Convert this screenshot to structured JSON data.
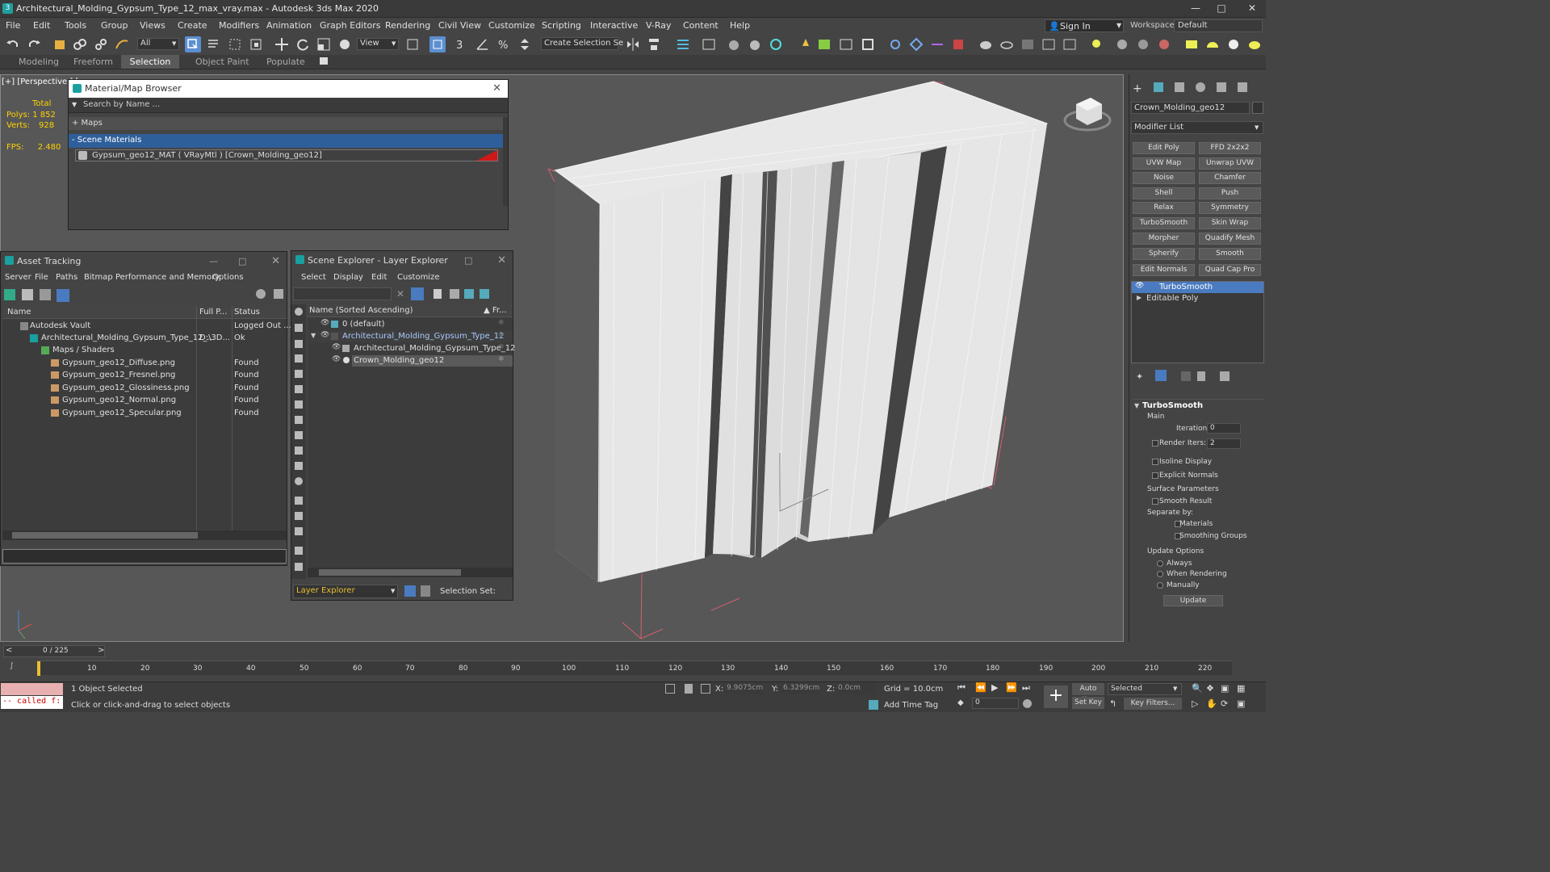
{
  "window": {
    "title": "Architectural_Molding_Gypsum_Type_12_max_vray.max - Autodesk 3ds Max 2020"
  },
  "menu": [
    "File",
    "Edit",
    "Tools",
    "Group",
    "Views",
    "Create",
    "Modifiers",
    "Animation",
    "Graph Editors",
    "Rendering",
    "Civil View",
    "Customize",
    "Scripting",
    "Interactive",
    "V-Ray",
    "Content",
    "Help"
  ],
  "signin": {
    "label": "Sign In"
  },
  "workspaces": {
    "label": "Workspaces:",
    "value": "Default"
  },
  "toolbar": {
    "filter_value": "All",
    "view_value": "View",
    "create_selection_set": "Create Selection Se"
  },
  "ribbon": {
    "tabs": [
      "Modeling",
      "Freeform",
      "Selection",
      "Object Paint",
      "Populate"
    ]
  },
  "viewport": {
    "label": "[+] [Perspective ] [",
    "stats": {
      "total_label": "Total",
      "polys_label": "Polys:",
      "polys_value": "1 852",
      "verts_label": "Verts:",
      "verts_value": "928",
      "fps_label": "FPS:",
      "fps_value": "2.480"
    }
  },
  "material_browser": {
    "title": "Material/Map Browser",
    "search_placeholder": "Search by Name ...",
    "maps_label": "+ Maps",
    "scene_materials_label": "- Scene Materials",
    "material_item": "Gypsum_geo12_MAT ( VRayMtl ) [Crown_Molding_geo12]"
  },
  "asset_tracking": {
    "title": "Asset Tracking",
    "menu": [
      "Server",
      "File",
      "Paths",
      "Bitmap Performance and Memory",
      "Options"
    ],
    "columns": [
      "Name",
      "Full P...",
      "Status"
    ],
    "rows": [
      {
        "name": "Autodesk Vault",
        "path": "",
        "status": "Logged Out ..."
      },
      {
        "name": "Architectural_Molding_Gypsum_Type_12_...",
        "path": "D:\\3D...",
        "status": "Ok"
      },
      {
        "name": "Maps / Shaders",
        "path": "",
        "status": ""
      },
      {
        "name": "Gypsum_geo12_Diffuse.png",
        "path": "",
        "status": "Found"
      },
      {
        "name": "Gypsum_geo12_Fresnel.png",
        "path": "",
        "status": "Found"
      },
      {
        "name": "Gypsum_geo12_Glossiness.png",
        "path": "",
        "status": "Found"
      },
      {
        "name": "Gypsum_geo12_Normal.png",
        "path": "",
        "status": "Found"
      },
      {
        "name": "Gypsum_geo12_Specular.png",
        "path": "",
        "status": "Found"
      }
    ]
  },
  "scene_explorer": {
    "title": "Scene Explorer - Layer Explorer",
    "menu": [
      "Select",
      "Display",
      "Edit",
      "Customize"
    ],
    "col_name": "Name (Sorted Ascending)",
    "col_fr": "▲ Fr...",
    "items": [
      {
        "label": "0 (default)"
      },
      {
        "label": "Architectural_Molding_Gypsum_Type_12"
      },
      {
        "label": "Architectural_Molding_Gypsum_Type_12"
      },
      {
        "label": "Crown_Molding_geo12"
      }
    ],
    "footer_dropdown": "Layer Explorer",
    "selection_set_label": "Selection Set:"
  },
  "command_panel": {
    "object_name": "Crown_Molding_geo12",
    "modifier_list": "Modifier List",
    "buttons": [
      "Edit Poly",
      "FFD 2x2x2",
      "UVW Map",
      "Unwrap UVW",
      "Noise",
      "Chamfer",
      "Shell",
      "Push",
      "Relax",
      "Symmetry",
      "TurboSmooth",
      "Skin Wrap",
      "Morpher",
      "Quadify Mesh",
      "Spherify",
      "Smooth",
      "Edit Normals",
      "Quad Cap Pro"
    ],
    "stack": [
      "TurboSmooth",
      "Editable Poly"
    ],
    "rollout": {
      "title": "TurboSmooth",
      "main": "Main",
      "iterations_label": "Iterations:",
      "iterations_value": "0",
      "render_iters_label": "Render Iters:",
      "render_iters_value": "2",
      "isoline": "Isoline Display",
      "explicit_normals": "Explicit Normals",
      "surface_params": "Surface Parameters",
      "smooth_result": "Smooth Result",
      "separate_by": "Separate by:",
      "materials": "Materials",
      "smoothing_groups": "Smoothing Groups",
      "update_options": "Update Options",
      "always": "Always",
      "when_rendering": "When Rendering",
      "manually": "Manually",
      "update_btn": "Update"
    }
  },
  "timeline": {
    "frame_counter": "0 / 225",
    "ticks": [
      "10",
      "20",
      "30",
      "40",
      "50",
      "60",
      "70",
      "80",
      "90",
      "100",
      "110",
      "120",
      "130",
      "140",
      "150",
      "160",
      "170",
      "180",
      "190",
      "200",
      "210",
      "220"
    ]
  },
  "status": {
    "maxscript": "-- called f:",
    "objects_selected": "1 Object Selected",
    "prompt": "Click or click-and-drag to select objects",
    "x_label": "X:",
    "x_value": "9.9075cm",
    "y_label": "Y:",
    "y_value": "6.3299cm",
    "z_label": "Z:",
    "z_value": "0.0cm",
    "grid": "Grid = 10.0cm",
    "add_time_tag": "Add Time Tag",
    "auto_key": "Auto Key",
    "set_key": "Set Key",
    "selected_dropdown": "Selected",
    "key_filters": "Key Filters...",
    "frame_value": "0"
  }
}
